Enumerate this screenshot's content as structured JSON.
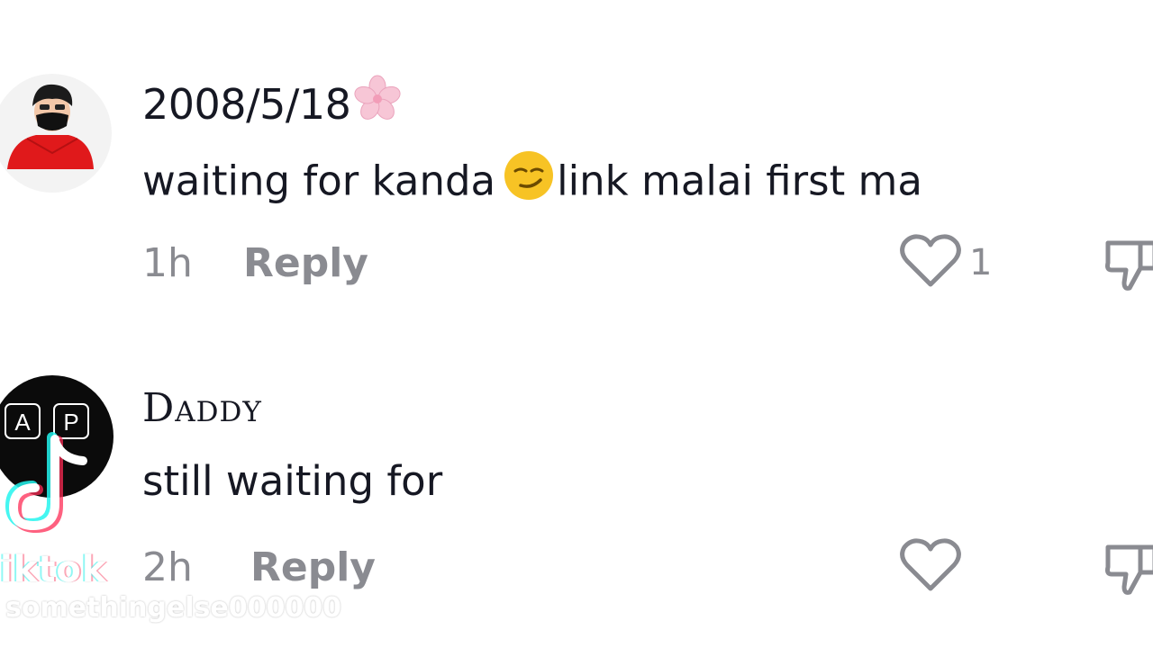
{
  "comments": [
    {
      "username": "2008/5/18",
      "username_decoration_icon": "cherry-blossom-icon",
      "text_before_emoji": "waiting for kanda",
      "emoji_icon": "smirking-face-emoji",
      "text_after_emoji": "link malai first ma",
      "time": "1h",
      "reply_label": "Reply",
      "like_count": "1"
    },
    {
      "username": "Daddy",
      "avatar_letters": [
        "A",
        "P"
      ],
      "text": "still waiting for",
      "time": "2h",
      "reply_label": "Reply",
      "like_count": ""
    }
  ],
  "watermark": {
    "brand": "TikTok",
    "brand_visible": "iktok",
    "user": "somethingelse000000"
  },
  "colors": {
    "text_primary": "#161823",
    "text_secondary": "#8a8b91",
    "background": "#ffffff"
  }
}
